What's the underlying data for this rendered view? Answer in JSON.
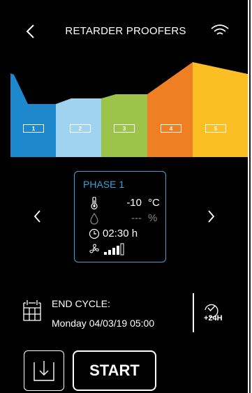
{
  "header": {
    "title": "RETARDER PROOFERS",
    "back_icon": "chevron-left-icon",
    "wifi_icon": "wifi-icon"
  },
  "phases": {
    "labels": [
      "1",
      "2",
      "3",
      "4",
      "5"
    ],
    "colors": [
      "#1e88cc",
      "#9fd3ef",
      "#9cc34a",
      "#ef7f22",
      "#fbbf24"
    ]
  },
  "phase_panel": {
    "title": "PHASE 1",
    "temperature_value": "-10",
    "temperature_unit": "°C",
    "humidity_value": "---",
    "humidity_unit": "%",
    "duration_value": "02:30 h",
    "fan_level": 4,
    "fan_level_max": 5,
    "accent_color": "#3ba3d9"
  },
  "end_cycle": {
    "label": "END CYCLE:",
    "date": "Monday 04/03/19  05:00",
    "plus_label": "+24H"
  },
  "footer": {
    "start_label": "START",
    "download_icon": "download-icon"
  }
}
